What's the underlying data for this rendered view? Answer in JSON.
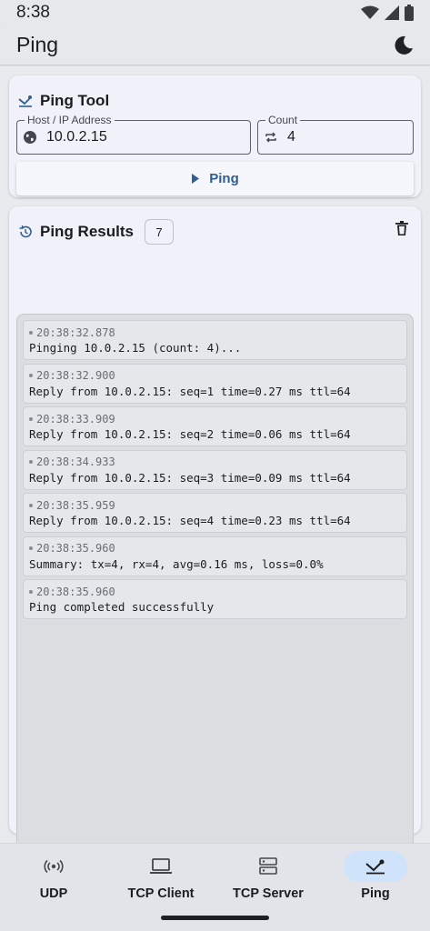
{
  "status_bar": {
    "time": "8:38"
  },
  "app_bar": {
    "title": "Ping"
  },
  "ping_tool": {
    "title": "Ping Tool",
    "host_label": "Host / IP Address",
    "host_value": "10.0.2.15",
    "count_label": "Count",
    "count_value": "4",
    "button_label": "Ping"
  },
  "results": {
    "title": "Ping Results",
    "count": "7",
    "entries": [
      {
        "time": "20:38:32.878",
        "message": "Pinging 10.0.2.15 (count: 4)..."
      },
      {
        "time": "20:38:32.900",
        "message": "Reply from 10.0.2.15: seq=1 time=0.27 ms ttl=64"
      },
      {
        "time": "20:38:33.909",
        "message": "Reply from 10.0.2.15: seq=2 time=0.06 ms ttl=64"
      },
      {
        "time": "20:38:34.933",
        "message": "Reply from 10.0.2.15: seq=3 time=0.09 ms ttl=64"
      },
      {
        "time": "20:38:35.959",
        "message": "Reply from 10.0.2.15: seq=4 time=0.23 ms ttl=64"
      },
      {
        "time": "20:38:35.960",
        "message": "Summary: tx=4, rx=4, avg=0.16 ms, loss=0.0%"
      },
      {
        "time": "20:38:35.960",
        "message": "Ping completed successfully"
      }
    ]
  },
  "bottom_nav": {
    "items": [
      {
        "label": "UDP",
        "icon": "broadcast-icon",
        "active": false
      },
      {
        "label": "TCP Client",
        "icon": "laptop-icon",
        "active": false
      },
      {
        "label": "TCP Server",
        "icon": "server-icon",
        "active": false
      },
      {
        "label": "Ping",
        "icon": "ping-icon",
        "active": true
      }
    ]
  },
  "colors": {
    "accent": "#2f5e8f",
    "active_nav": "#cfe3fb",
    "card_bg": "#f1f2f9"
  }
}
